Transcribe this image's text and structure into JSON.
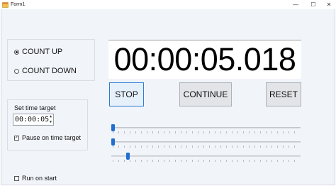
{
  "window": {
    "title": "Form1",
    "minimize_glyph": "—",
    "maximize_glyph": "☐",
    "close_glyph": "✕"
  },
  "mode": {
    "options": [
      {
        "label": "COUNT UP",
        "checked": true
      },
      {
        "label": "COUNT DOWN",
        "checked": false
      }
    ]
  },
  "target": {
    "label": "Set time target",
    "value": "00:00:05",
    "spin_up": "▲",
    "spin_down": "▼",
    "pause_label": "Pause on time target",
    "pause_checked": true
  },
  "run_on_start": {
    "label": "Run on start",
    "checked": false
  },
  "display": {
    "time": "00:00:05.018"
  },
  "buttons": {
    "stop": "STOP",
    "continue": "CONTINUE",
    "reset": "RESET"
  },
  "sliders": [
    {
      "fraction": 0.0
    },
    {
      "fraction": 0.0
    },
    {
      "fraction": 0.08
    }
  ],
  "colors": {
    "accent": "#1f6fd1",
    "background": "#f1f4f9"
  }
}
